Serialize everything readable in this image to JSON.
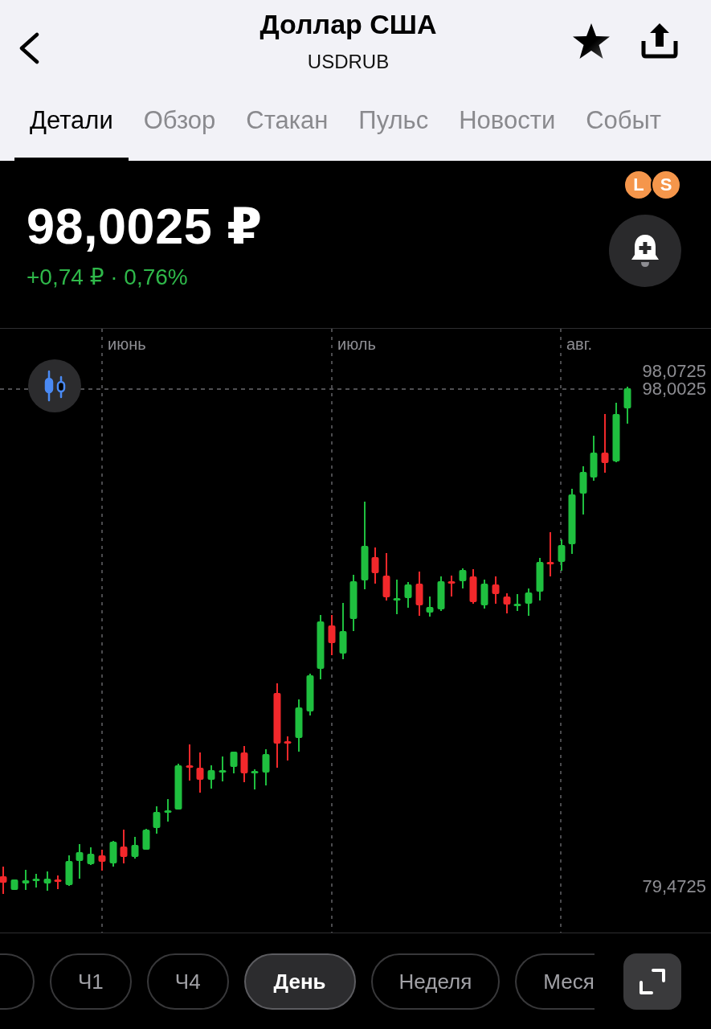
{
  "header": {
    "title": "Доллар США",
    "ticker": "USDRUB",
    "favorite": true
  },
  "tabs": [
    {
      "label": "Детали",
      "selected": true
    },
    {
      "label": "Обзор",
      "selected": false
    },
    {
      "label": "Стакан",
      "selected": false
    },
    {
      "label": "Пульс",
      "selected": false
    },
    {
      "label": "Новости",
      "selected": false
    },
    {
      "label": "Событ",
      "selected": false
    }
  ],
  "quote": {
    "badges": [
      "L",
      "S"
    ],
    "price": "98,0025 ₽",
    "change": "+0,74 ₽ · 0,76%"
  },
  "chart": {
    "months": [
      "июнь",
      "июль",
      "авг."
    ],
    "price_labels": [
      "98,0725",
      "98,0025",
      "79,4725"
    ]
  },
  "periods": [
    {
      "selected": false
    },
    {
      "label": "Ч1",
      "selected": false
    },
    {
      "label": "Ч4",
      "selected": false
    },
    {
      "label": "День",
      "selected": true
    },
    {
      "label": "Неделя",
      "selected": false
    },
    {
      "label": "Меся",
      "selected": false
    }
  ]
}
